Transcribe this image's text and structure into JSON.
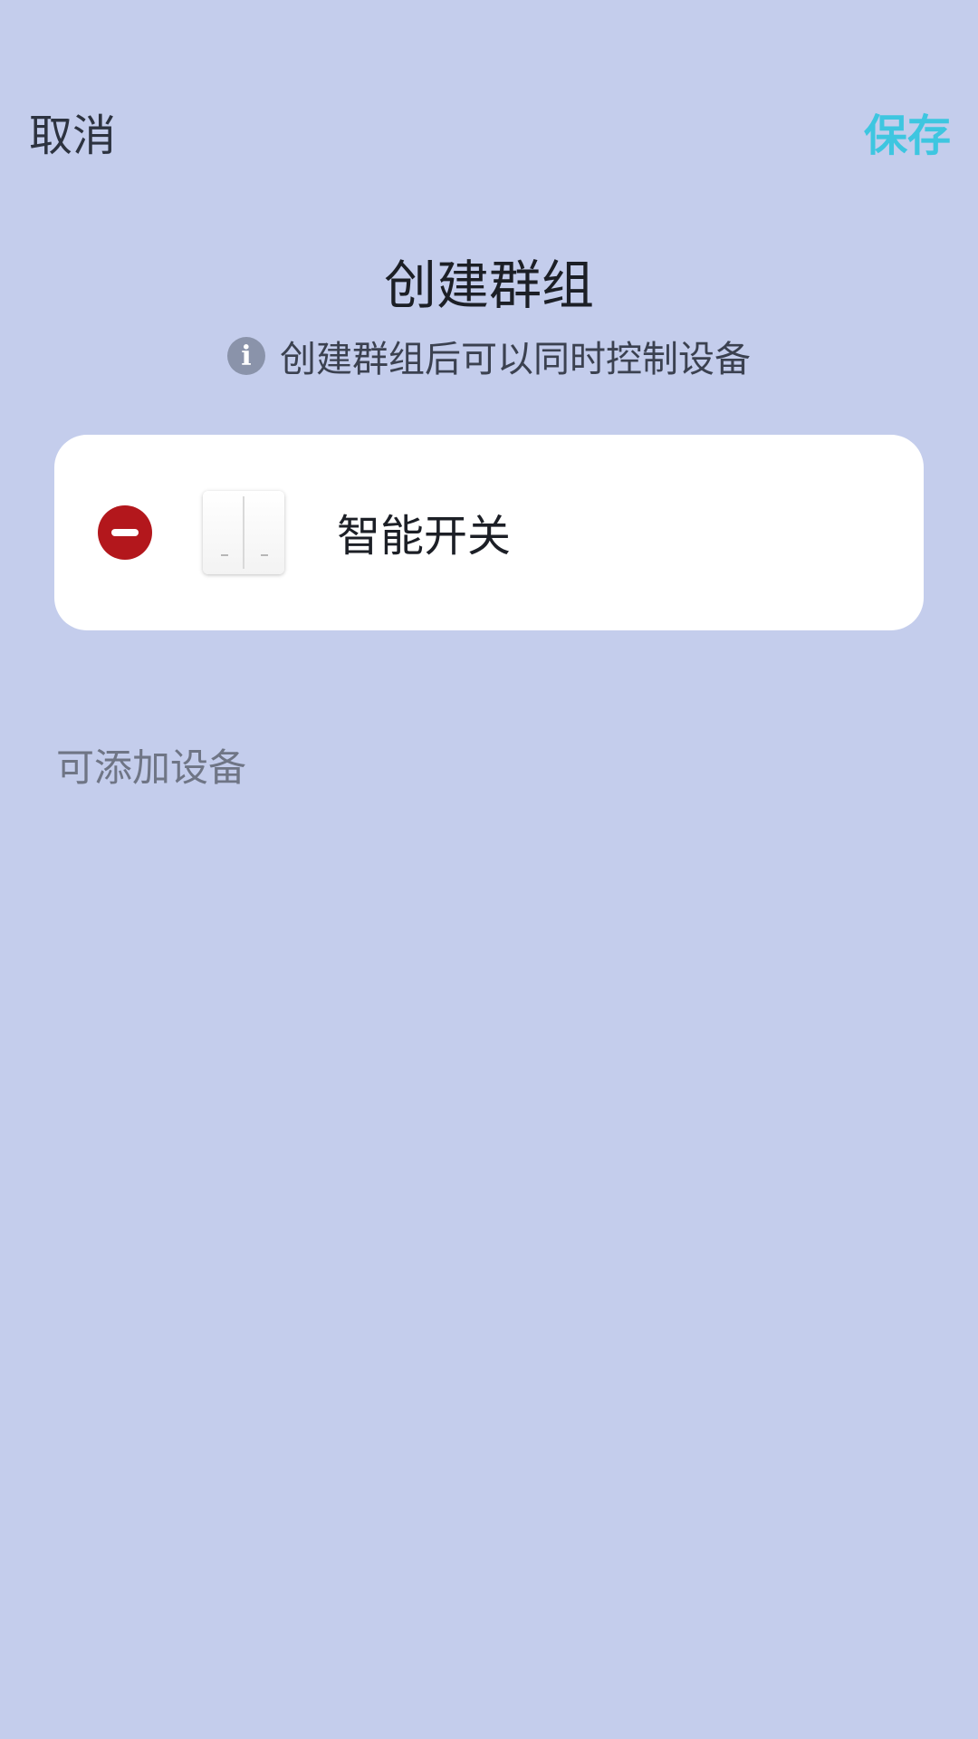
{
  "header": {
    "cancel_label": "取消",
    "save_label": "保存"
  },
  "title": "创建群组",
  "subtitle": {
    "info_glyph": "i",
    "text": "创建群组后可以同时控制设备"
  },
  "selected_devices": [
    {
      "name": "智能开关",
      "icon": "wall-switch-icon"
    }
  ],
  "available_section": {
    "label": "可添加设备"
  },
  "colors": {
    "background": "#c4cdec",
    "accent": "#3ec6e0",
    "remove": "#b3171c",
    "card": "#ffffff"
  }
}
